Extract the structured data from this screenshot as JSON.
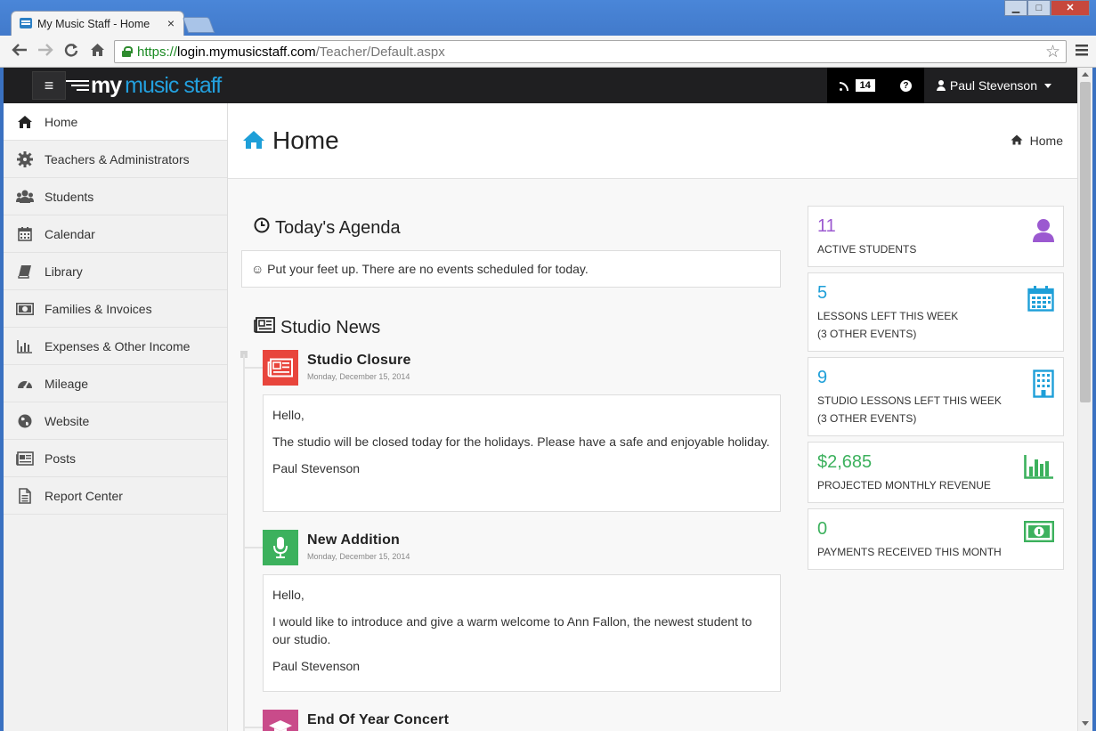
{
  "browser": {
    "tab_title": "My Music Staff - Home",
    "tab_close": "×",
    "url_scheme": "https://",
    "url_host": "login.mymusicstaff.com",
    "url_path": "/Teacher/Default.aspx",
    "window_buttons": [
      "▁",
      "□",
      "✕"
    ]
  },
  "app": {
    "logo_my": "my",
    "logo_rest": "music staff",
    "feed_count": "14",
    "help_label": "?",
    "user_name": "Paul Stevenson"
  },
  "sidebar": {
    "items": [
      {
        "label": "Home",
        "icon": "home-icon"
      },
      {
        "label": "Teachers & Administrators",
        "icon": "gear-icon"
      },
      {
        "label": "Students",
        "icon": "users-icon"
      },
      {
        "label": "Calendar",
        "icon": "calendar-icon"
      },
      {
        "label": "Library",
        "icon": "book-icon"
      },
      {
        "label": "Families & Invoices",
        "icon": "money-icon"
      },
      {
        "label": "Expenses & Other Income",
        "icon": "bar-chart-icon"
      },
      {
        "label": "Mileage",
        "icon": "dashboard-icon"
      },
      {
        "label": "Website",
        "icon": "globe-icon"
      },
      {
        "label": "Posts",
        "icon": "newspaper-icon"
      },
      {
        "label": "Report Center",
        "icon": "document-icon"
      }
    ]
  },
  "page": {
    "title": "Home",
    "breadcrumb": "Home"
  },
  "agenda": {
    "title": "Today's Agenda",
    "message": "☺ Put your feet up. There are no events scheduled for today."
  },
  "news": {
    "title": "Studio News",
    "posts": [
      {
        "title": "Studio Closure",
        "date": "Monday, December 15, 2014",
        "icon": "newspaper-icon",
        "color": "#e8453c",
        "greeting": "Hello,",
        "body": "The studio will be closed today for the holidays. Please have a safe and enjoyable holiday.",
        "signature": "Paul Stevenson"
      },
      {
        "title": "New Addition",
        "date": "Monday, December 15, 2014",
        "icon": "microphone-icon",
        "color": "#3cb15d",
        "greeting": "Hello,",
        "body": "I would like to introduce and give a warm welcome to Ann Fallon, the newest student to our studio.",
        "signature": "Paul Stevenson"
      },
      {
        "title": "End Of Year Concert",
        "icon": "graduation-cap-icon",
        "color": "#c94b8a"
      }
    ]
  },
  "stats": [
    {
      "value": "11",
      "label": "ACTIVE STUDENTS",
      "sublabel": "",
      "color": "#9b59d0",
      "icon": "user-icon"
    },
    {
      "value": "5",
      "label": "LESSONS LEFT THIS WEEK",
      "sublabel": "(3 OTHER EVENTS)",
      "color": "#1e9fd8",
      "icon": "calendar-icon"
    },
    {
      "value": "9",
      "label": "STUDIO LESSONS LEFT THIS WEEK",
      "sublabel": "(3 OTHER EVENTS)",
      "color": "#1e9fd8",
      "icon": "building-icon"
    },
    {
      "value": "$2,685",
      "label": "PROJECTED MONTHLY REVENUE",
      "sublabel": "",
      "color": "#3cb15d",
      "icon": "bar-chart-icon"
    },
    {
      "value": "0",
      "label": "PAYMENTS RECEIVED THIS MONTH",
      "sublabel": "",
      "color": "#3cb15d",
      "icon": "money-icon"
    }
  ]
}
